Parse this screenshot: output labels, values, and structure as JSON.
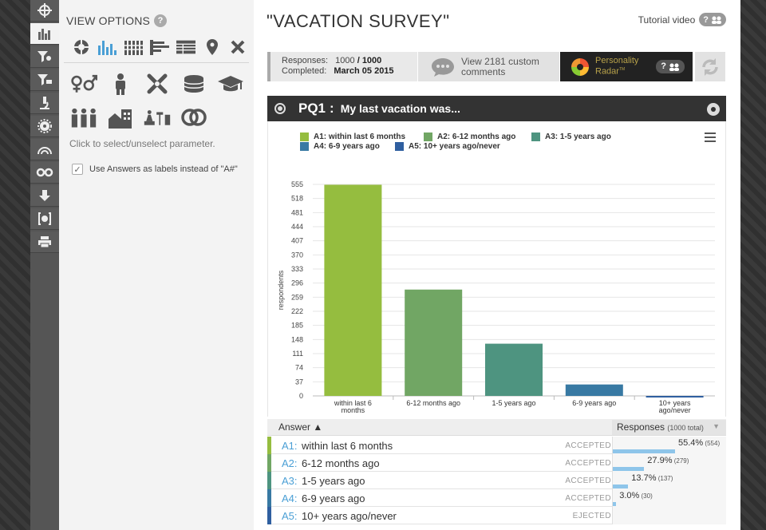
{
  "sidebar_rail": {
    "items": [
      {
        "icon": "crosshair-icon",
        "active": false
      },
      {
        "icon": "bar-chart-icon",
        "active": true
      },
      {
        "icon": "filter-location-icon",
        "active": false
      },
      {
        "icon": "filter-comment-icon",
        "active": false
      },
      {
        "icon": "microscope-icon",
        "active": false
      },
      {
        "icon": "gear-icon",
        "active": false
      },
      {
        "icon": "rainbow-icon",
        "active": false
      },
      {
        "icon": "infinity-icon",
        "active": false
      },
      {
        "icon": "download-icon",
        "active": false
      },
      {
        "icon": "brain-icon",
        "active": false
      },
      {
        "icon": "print-icon",
        "active": false
      }
    ]
  },
  "options": {
    "title": "VIEW OPTIONS",
    "help": "?",
    "chart_types": [
      "pie-chart-icon",
      "vertical-bar-icon",
      "stacked-bar-icon",
      "horizontal-bar-icon",
      "table-icon",
      "map-pin-icon",
      "close-icon"
    ],
    "params_row1": [
      "gender-icon",
      "person-icon",
      "dna-icon",
      "coins-icon",
      "graduation-cap-icon"
    ],
    "params_row2": [
      "family-icon",
      "home-city-icon",
      "work-icon",
      "rings-icon"
    ],
    "hint": "Click to select/unselect parameter.",
    "checkbox_label": "Use Answers as labels instead of \"A#\"",
    "checkbox_mark": "✓"
  },
  "header": {
    "title": "\"VACATION SURVEY\"",
    "tutorial_label": "Tutorial video",
    "tutorial_help": "?"
  },
  "stats": {
    "responses_label": "Responses:",
    "responses_value": "1000",
    "responses_total": "/ 1000",
    "completed_label": "Completed:",
    "completed_value": "March 05 2015",
    "comments_line1": "View 2181 custom",
    "comments_line2": "comments",
    "radar_line1": "Personality",
    "radar_line2": "Radar",
    "radar_tm": "TM",
    "radar_help": "?"
  },
  "question": {
    "code": "PQ1",
    "colon": ":",
    "text": "My last vacation was..."
  },
  "colors": {
    "a1": "#95bd3f",
    "a2": "#71a664",
    "a3": "#4e9480",
    "a4": "#3879a3",
    "a5": "#2f5fa0"
  },
  "chart_data": {
    "type": "bar",
    "legend": [
      "A1: within last 6 months",
      "A2: 6-12 months ago",
      "A3: 1-5 years ago",
      "A4: 6-9 years ago",
      "A5: 10+ years ago/never"
    ],
    "categories": [
      "within last 6 months",
      "6-12 months ago",
      "1-5 years ago",
      "6-9 years ago",
      "10+ years ago/never"
    ],
    "values": [
      554,
      279,
      137,
      30,
      0
    ],
    "ylabel": "respondents",
    "xlabel": "",
    "ylim": [
      0,
      555
    ],
    "yticks": [
      "0",
      "37",
      "74",
      "111",
      "148",
      "185",
      "222",
      "259",
      "296",
      "333",
      "370",
      "407",
      "444",
      "481",
      "518",
      "555"
    ],
    "grid": true
  },
  "results": {
    "answer_header": "Answer ▲",
    "responses_header": "Responses",
    "responses_total": "(1000 total)",
    "sort_caret": "▼",
    "rows": [
      {
        "code": "A1:",
        "text": "within last 6 months",
        "status": "ACCEPTED",
        "pct": "55.4%",
        "count": "(554)",
        "fraction": 0.554
      },
      {
        "code": "A2:",
        "text": "6-12 months ago",
        "status": "ACCEPTED",
        "pct": "27.9%",
        "count": "(279)",
        "fraction": 0.279
      },
      {
        "code": "A3:",
        "text": "1-5 years ago",
        "status": "ACCEPTED",
        "pct": "13.7%",
        "count": "(137)",
        "fraction": 0.137
      },
      {
        "code": "A4:",
        "text": "6-9 years ago",
        "status": "ACCEPTED",
        "pct": "3.0%",
        "count": "(30)",
        "fraction": 0.03
      },
      {
        "code": "A5:",
        "text": "10+ years ago/never",
        "status": "EJECTED",
        "pct": "",
        "count": "",
        "fraction": 0
      }
    ]
  }
}
